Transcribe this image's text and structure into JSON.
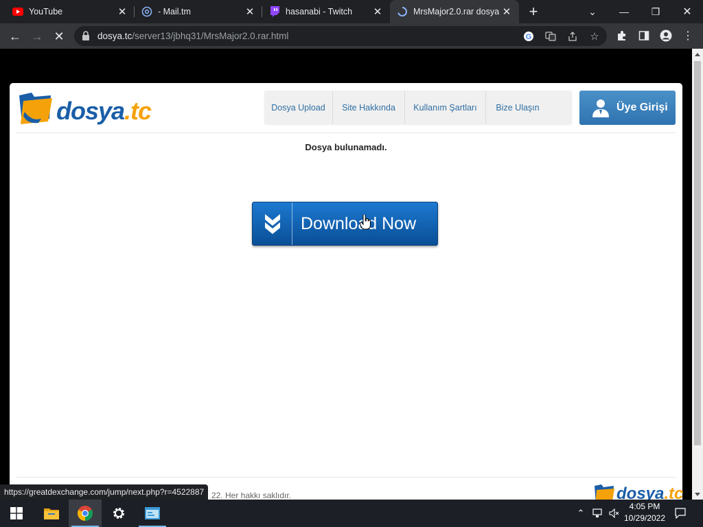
{
  "browser": {
    "tabs": [
      {
        "title": "YouTube",
        "icon": "youtube-icon",
        "active": false
      },
      {
        "title": "- Mail.tm",
        "icon": "at-sign-icon",
        "active": false
      },
      {
        "title": "hasanabi - Twitch",
        "icon": "twitch-icon",
        "active": false
      },
      {
        "title": "MrsMajor2.0.rar dosya",
        "icon": "loading-spinner-icon",
        "active": true
      }
    ],
    "address": {
      "domain": "dosya.tc",
      "path": "/server13/jbhq31/MrsMajor2.0.rar.html"
    },
    "status_url": "https://greatdexchange.com/jump/next.php?r=4522887"
  },
  "page": {
    "logo": {
      "main": "dosya",
      "suffix": ".tc"
    },
    "nav": [
      {
        "label": "Dosya Upload"
      },
      {
        "label": "Site Hakkında"
      },
      {
        "label": "Kullanım Şartları"
      },
      {
        "label": "Bize Ulaşın"
      }
    ],
    "login_label": "Üye Girişi",
    "not_found_text": "Dosya bulunamadı.",
    "download_label": "Download Now",
    "copyright": "22. Her hakkı saklıdır.",
    "colors": {
      "brand_blue": "#1a5ea8",
      "brand_orange": "#f5a20a",
      "button_blue": "#0a5bb0"
    }
  },
  "taskbar": {
    "apps": [
      {
        "name": "start-button",
        "icon": "windows-icon"
      },
      {
        "name": "file-explorer",
        "icon": "folder-icon"
      },
      {
        "name": "chrome",
        "icon": "chrome-icon",
        "active": true
      },
      {
        "name": "settings",
        "icon": "gear-icon"
      },
      {
        "name": "control-panel",
        "icon": "window-app-icon"
      }
    ],
    "time": "4:05 PM",
    "date": "10/29/2022"
  }
}
